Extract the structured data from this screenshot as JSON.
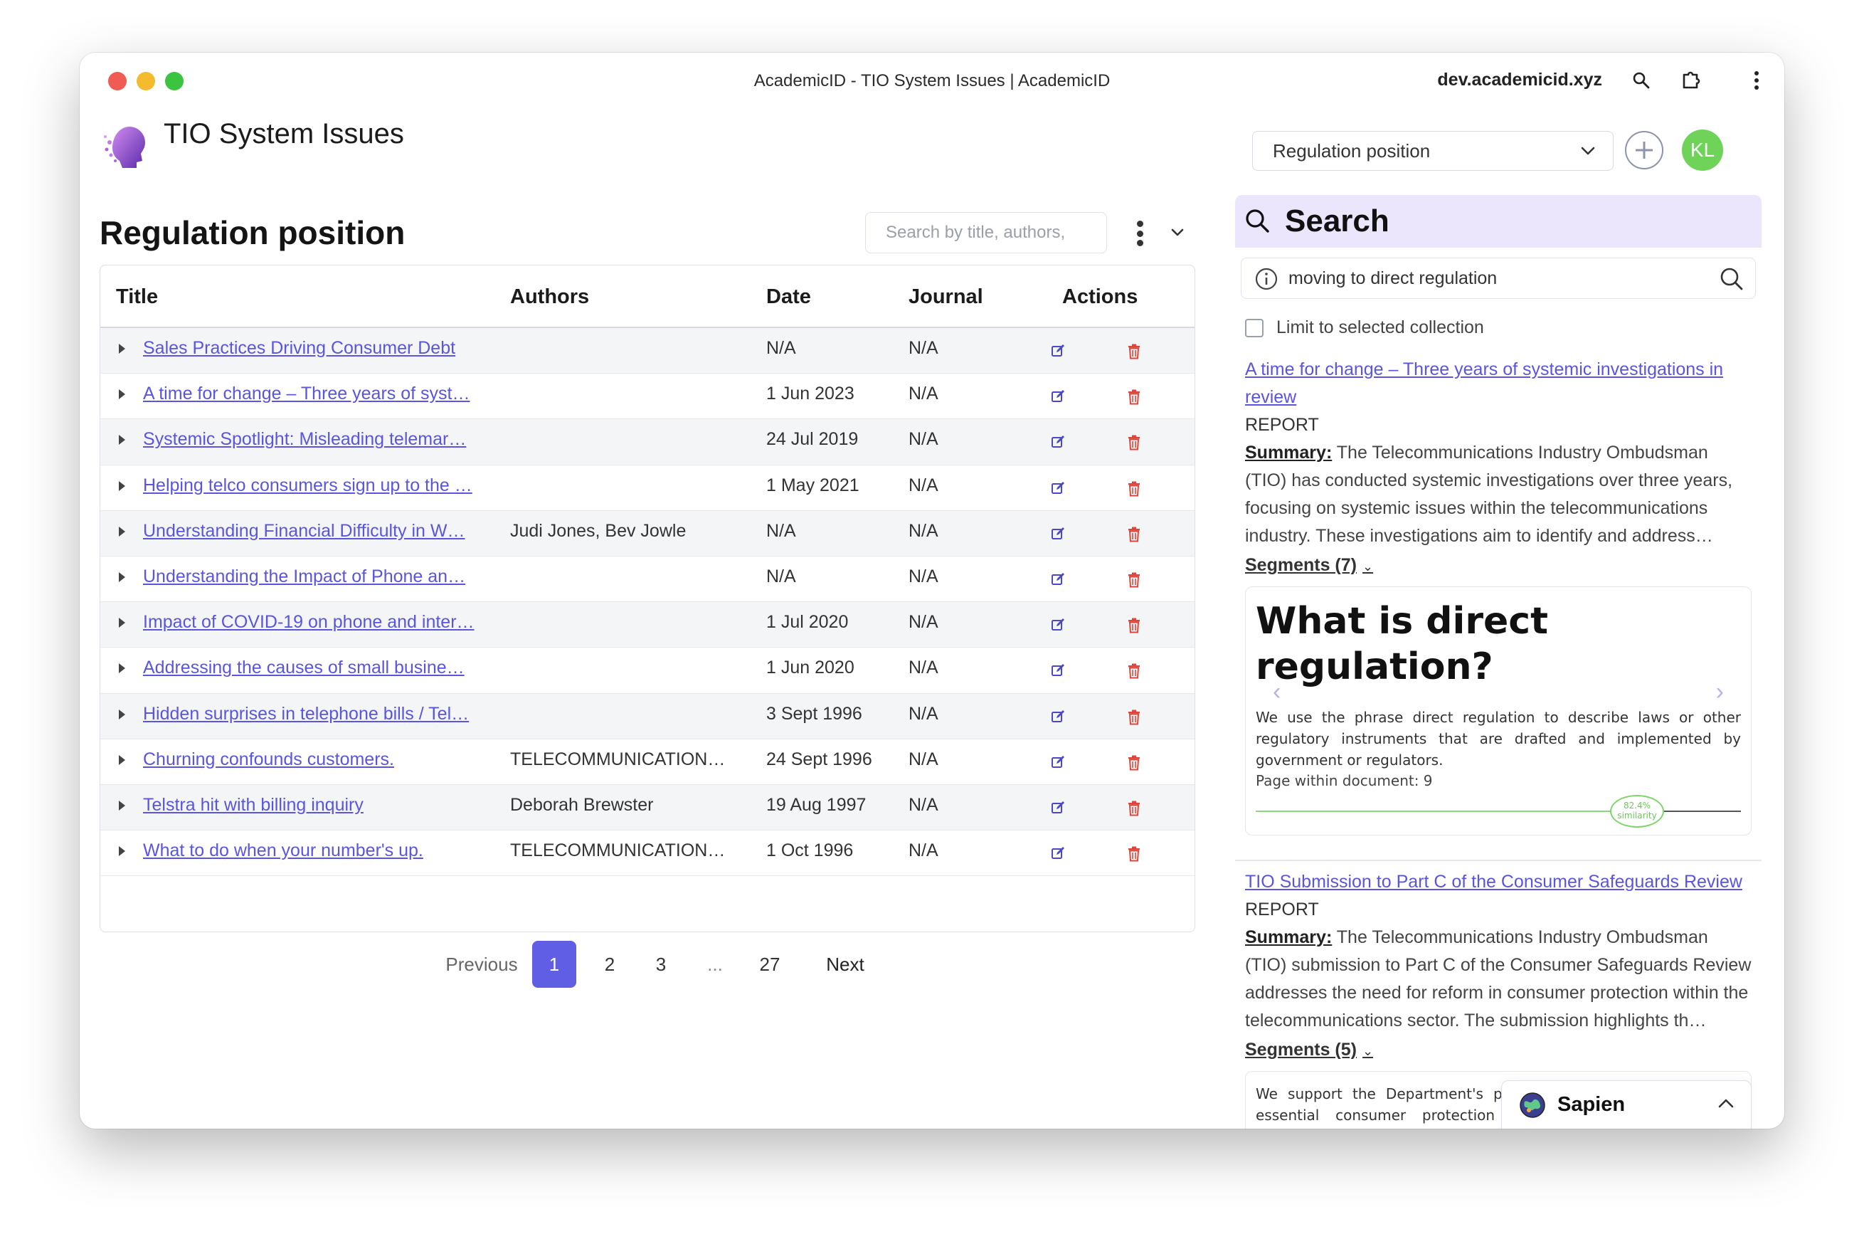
{
  "browser": {
    "tab_title": "AcademicID - TIO System Issues | AcademicID",
    "domain": "dev.academicid.xyz"
  },
  "app": {
    "title": "TIO System Issues",
    "view_select": "Regulation position",
    "avatar_initials": "KL",
    "accent_color": "#5f5ee5",
    "avatar_color": "#6fd35a"
  },
  "main": {
    "section_title": "Regulation position",
    "search_placeholder": "Search by title, authors,",
    "columns": [
      "Title",
      "Authors",
      "Date",
      "Journal",
      "Actions"
    ],
    "rows": [
      {
        "title": "Sales Practices Driving Consumer Debt",
        "authors": "",
        "date": "N/A",
        "journal": "N/A"
      },
      {
        "title": "A time for change – Three years of syst…",
        "authors": "",
        "date": "1 Jun 2023",
        "journal": "N/A"
      },
      {
        "title": "Systemic Spotlight: Misleading telemar…",
        "authors": "",
        "date": "24 Jul 2019",
        "journal": "N/A"
      },
      {
        "title": "Helping telco consumers sign up to the …",
        "authors": "",
        "date": "1 May 2021",
        "journal": "N/A"
      },
      {
        "title": "Understanding Financial Difficulty in W…",
        "authors": "Judi Jones, Bev Jowle",
        "date": "N/A",
        "journal": "N/A"
      },
      {
        "title": "Understanding the Impact of Phone an…",
        "authors": "",
        "date": "N/A",
        "journal": "N/A"
      },
      {
        "title": "Impact of COVID-19 on phone and inter…",
        "authors": "",
        "date": "1 Jul 2020",
        "journal": "N/A"
      },
      {
        "title": "Addressing the causes of small busine…",
        "authors": "",
        "date": "1 Jun 2020",
        "journal": "N/A"
      },
      {
        "title": "Hidden surprises in telephone bills / Tel…",
        "authors": "",
        "date": "3 Sept 1996",
        "journal": "N/A"
      },
      {
        "title": "Churning confounds customers.",
        "authors": "TELECOMMUNICATIONS I…",
        "date": "24 Sept 1996",
        "journal": "N/A"
      },
      {
        "title": "Telstra hit with billing inquiry",
        "authors": "Deborah Brewster",
        "date": "19 Aug 1997",
        "journal": "N/A"
      },
      {
        "title": "What to do when your number's up.",
        "authors": "TELECOMMUNICATIONS I…",
        "date": "1 Oct 1996",
        "journal": "N/A"
      }
    ],
    "pagination": {
      "previous": "Previous",
      "pages": [
        "1",
        "2",
        "3",
        "...",
        "27"
      ],
      "current": "1",
      "next": "Next"
    }
  },
  "search_panel": {
    "heading": "Search",
    "query": "moving to direct regulation",
    "limit_label": "Limit to selected collection",
    "summary_label": "Summary:",
    "results": [
      {
        "title": "A time for change – Three years of systemic investigations in review",
        "type": "REPORT",
        "summary": "The Telecommunications Industry Ombudsman (TIO) has conducted systemic investigations over three years, focusing on systemic issues within the telecommunications industry. These investigations aim to identify and address…",
        "segments_label": "Segments (7)",
        "segment": {
          "heading": "What is direct regulation?",
          "text": "We use the phrase direct regulation to describe laws or other regulatory instruments that are drafted and implemented by government or regulators.",
          "page": "Page within document: 9",
          "similarity_value": "82.4%",
          "similarity_label": "similarity"
        }
      },
      {
        "title": "TIO Submission to Part C of the Consumer Safeguards Review",
        "type": "REPORT",
        "summary": "The Telecommunications Industry Ombudsman (TIO) submission to Part C of the Consumer Safeguards Review addresses the need for reform in consumer protection within the telecommunications sector. The submission highlights th…",
        "segments_label": "Segments (5)",
        "segment": {
          "text": "We support the Department's proposal for direct regulation of essential consumer protection matters. We encourage the Department to consider consolidating all essential"
        }
      }
    ]
  },
  "assistant": {
    "name": "Sapien"
  }
}
